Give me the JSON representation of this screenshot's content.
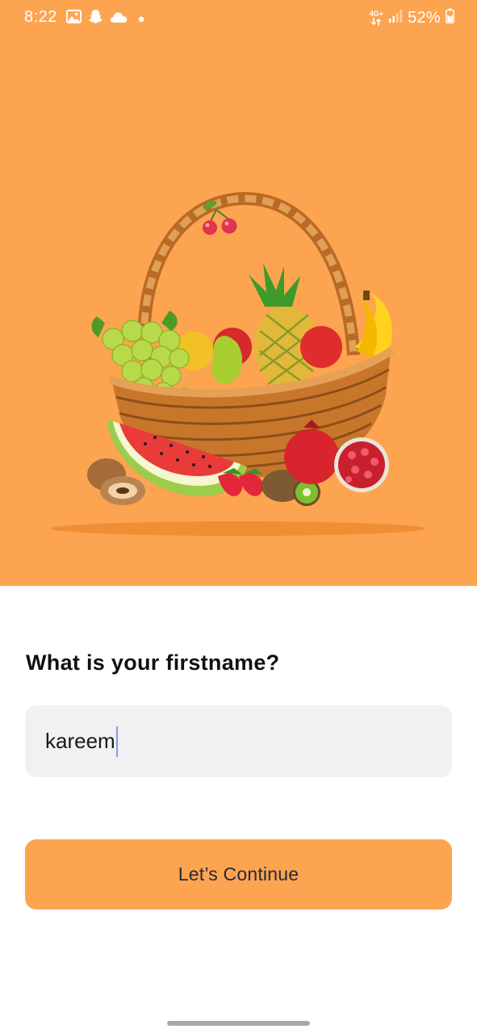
{
  "status_bar": {
    "time": "8:22",
    "left_icons": [
      "gallery-icon",
      "snapchat-icon",
      "cloud-icon",
      "dot-icon"
    ],
    "network_label": "4G+",
    "battery": "52%"
  },
  "hero": {
    "background": "#fda450",
    "illustration": "fruit-basket"
  },
  "form": {
    "question": "What is your firstname?",
    "name_value": "kareem"
  },
  "actions": {
    "continue_label": "Let’s Continue",
    "accent": "#fda450"
  }
}
